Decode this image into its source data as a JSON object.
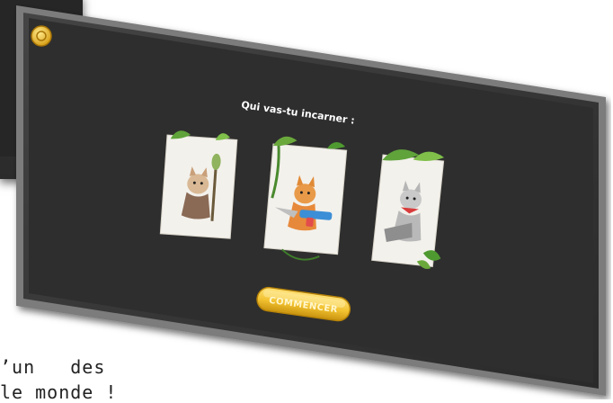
{
  "screen": {
    "prompt": "Qui vas-tu incarner :",
    "start_button_label": "COMMENCER"
  },
  "characters": [
    {
      "name": "cat-priest",
      "icon": "cat-with-staff"
    },
    {
      "name": "cat-water-gun",
      "icon": "cat-with-water-gun"
    },
    {
      "name": "cat-bandana",
      "icon": "cat-with-sword"
    }
  ],
  "background_text": {
    "line1": "’un   des",
    "line2": "le monde !"
  },
  "colors": {
    "panel": "#2b2b2b",
    "panel_border": "#6a6a6a",
    "accent_gold": "#f2c230",
    "leaf_green": "#5fa33a"
  }
}
